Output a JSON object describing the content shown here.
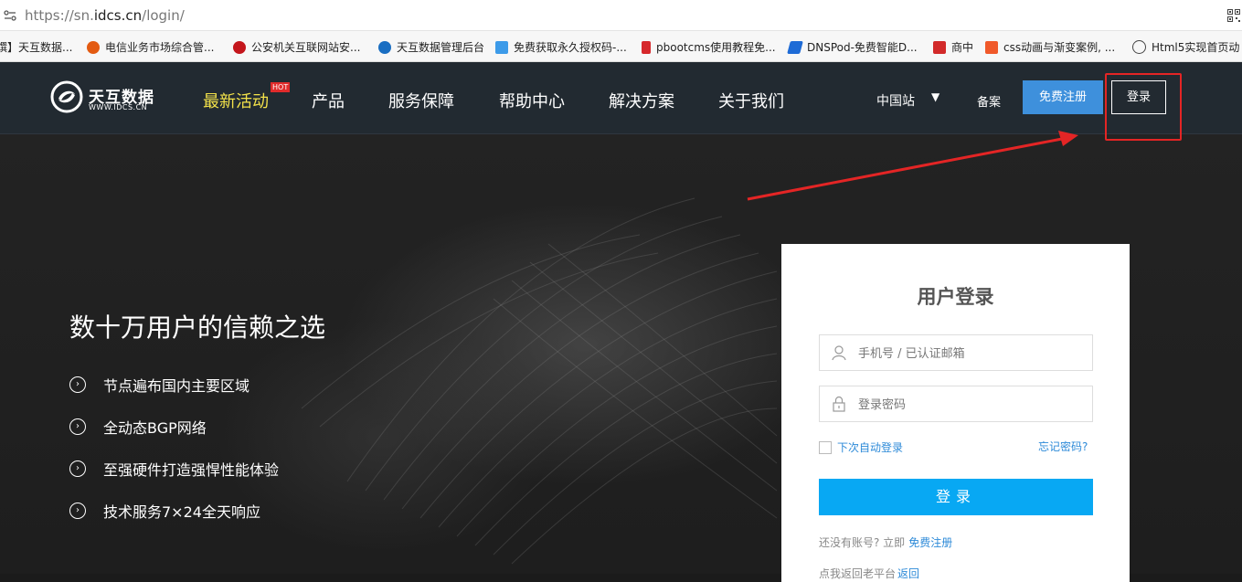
{
  "browser": {
    "url_prefix": "https://sn.",
    "url_domain": "idcs.cn",
    "url_path": "/login/",
    "bookmarks": [
      {
        "label": "馔】天互数据...",
        "icon": "tianhu-favicon",
        "color": "#2b7bd1"
      },
      {
        "label": "电信业务市场综合管...",
        "icon": "gear-favicon",
        "color": "#e35b12"
      },
      {
        "label": "公安机关互联网站安...",
        "icon": "police-emblem",
        "color": "#c4161c"
      },
      {
        "label": "天互数据管理后台",
        "icon": "tianhu-favicon",
        "color": "#1a6ec2"
      },
      {
        "label": "免费获取永久授权码-...",
        "icon": "p-favicon",
        "color": "#3d9be9"
      },
      {
        "label": "pbootcms使用教程免...",
        "icon": "d-favicon",
        "color": "#d6282c"
      },
      {
        "label": "DNSPod-免费智能D...",
        "icon": "dnspod-favicon",
        "color": "#1e6bd6"
      },
      {
        "label": "商中",
        "icon": "shangzhong-favicon",
        "color": "#d22a2a"
      },
      {
        "label": "css动画与渐变案例, ...",
        "icon": "c-favicon",
        "color": "#f0592a"
      },
      {
        "label": "Html5实现首页动",
        "icon": "globe-icon",
        "color": "#444444"
      }
    ]
  },
  "header": {
    "logo_brand": "天互数据",
    "logo_domain": "WWW.IDCS.CN",
    "nav": [
      "最新活动",
      "产品",
      "服务保障",
      "帮助中心",
      "解决方案",
      "关于我们"
    ],
    "hot_badge": "HOT",
    "region": "中国站",
    "region_caret": "▼",
    "beian": "备案",
    "register": "免费注册",
    "login": "登录"
  },
  "hero": {
    "title": "数十万用户的信赖之选",
    "features": [
      "节点遍布国内主要区域",
      "全动态BGP网络",
      "至强硬件打造强悍性能体验",
      "技术服务7×24全天响应"
    ]
  },
  "login_form": {
    "title": "用户登录",
    "username_placeholder": "手机号 / 已认证邮箱",
    "password_placeholder": "登录密码",
    "remember_label": "下次自动登录",
    "forgot_label": "忘记密码?",
    "submit_label": "登录",
    "no_account_text": "还没有账号? 立即",
    "register_link": "免费注册",
    "back_text": "点我返回老平台",
    "back_link": "返回"
  },
  "colors": {
    "header_bg": "#222a31",
    "register_btn": "#3e90dc",
    "submit_btn": "#08a8f3",
    "link": "#2d8ad8",
    "hot_nav": "#f3e24a",
    "annotation_red": "#e42525"
  }
}
